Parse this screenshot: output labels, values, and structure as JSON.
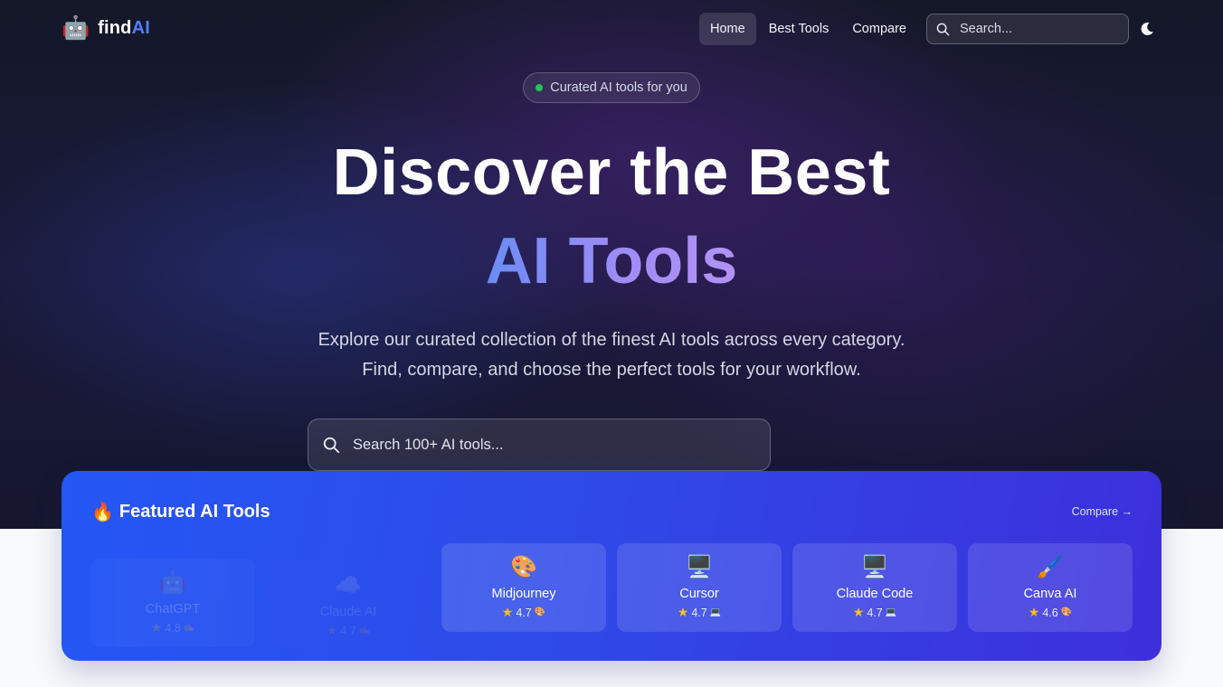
{
  "nav": {
    "logo": {
      "icon": "🤖",
      "text_main": "find",
      "text_accent": "AI"
    },
    "items": [
      {
        "label": "Home",
        "active": true
      },
      {
        "label": "Best Tools",
        "active": false
      },
      {
        "label": "Compare",
        "active": false
      }
    ],
    "search_placeholder": "Search...",
    "theme_icon": "moon-icon"
  },
  "hero": {
    "pill": "Curated AI tools for you",
    "title_line1": "Discover the Best",
    "title_line2": "AI Tools",
    "subtitle_line1": "Explore our curated collection of the finest AI tools across every category.",
    "subtitle_line2": "Find, compare, and choose the perfect tools for your workflow.",
    "search_placeholder": "Search 100+ AI tools..."
  },
  "featured": {
    "icon": "🔥",
    "title": "Featured AI Tools",
    "compare_link": "Compare →",
    "tools": [
      {
        "icon": "🤖",
        "name": "ChatGPT",
        "rating": "4.8",
        "tag": "✍️"
      },
      {
        "icon": "☁️",
        "name": "Claude AI",
        "rating": "4.7",
        "tag": "✍️"
      },
      {
        "icon": "🎨",
        "name": "Midjourney",
        "rating": "4.7",
        "tag": "🎨"
      },
      {
        "icon": "🖥️",
        "name": "Cursor",
        "rating": "4.7",
        "tag": "💻"
      },
      {
        "icon": "🖥️",
        "name": "Claude Code",
        "rating": "4.7",
        "tag": "💻"
      },
      {
        "icon": "🖌️",
        "name": "Canva AI",
        "rating": "4.6",
        "tag": "🎨"
      }
    ]
  },
  "colors": {
    "accent": "#4f7ff7",
    "featured_bg_start": "#2457f5",
    "featured_bg_end": "#3d2fdc",
    "status_dot": "#22c55e",
    "star": "#fbbf24"
  }
}
